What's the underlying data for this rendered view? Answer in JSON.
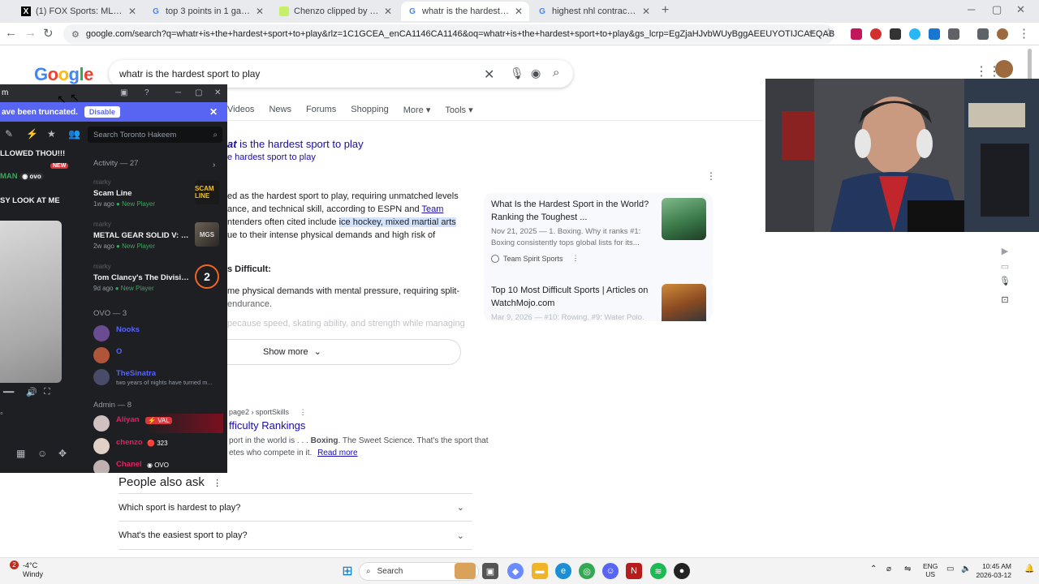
{
  "browser": {
    "tabs": [
      {
        "title": "(1) FOX Sports: MLB on X: \"THE",
        "favicon": "X",
        "active": false
      },
      {
        "title": "top 3 points in 1 game nba - G",
        "favicon": "G",
        "active": false
      },
      {
        "title": "Chenzo clipped by TheSinatra",
        "favicon": "twitch",
        "active": false
      },
      {
        "title": "whatr is the hardest sport to pl",
        "favicon": "G",
        "active": true
      },
      {
        "title": "highest nhl contract - Google S",
        "favicon": "G",
        "active": false
      }
    ],
    "new_tab": "+",
    "url": "google.com/search?q=whatr+is+the+hardest+sport+to+play&rlz=1C1GCEA_enCA1146CA1146&oq=whatr+is+the+hardest+sport+to+play&gs_lcrp=EgZjaHJvbWUyBggAEEUYOTIJCAEQABgNGIAEMgkIAhAAGA0Yg..."
  },
  "google": {
    "logo": "Google",
    "query": "whatr is the hardest sport to play",
    "tabs": [
      "Videos",
      "News",
      "Forums",
      "Shopping",
      "More",
      "Tools"
    ],
    "ai_overview": {
      "title_em": "at",
      "title_rest": " is the hardest sport to play",
      "subtitle": "e hardest sport to play",
      "lines": [
        "ed as the hardest sport to play, requiring unmatched levels",
        "ance, and technical skill, according to ESPN and ",
        "ntenders often cited include ",
        "ue to their intense physical demands and high risk of"
      ],
      "link_team": "Team",
      "highlight": "ice hockey, mixed martial arts",
      "heading": "s Difficult:",
      "line5": "me physical demands with mental pressure, requiring split-",
      "line6": "endurance.",
      "line7": "pecause speed, skating ability, and strength while managing",
      "show_more": "Show more"
    },
    "cards": [
      {
        "title": "What Is the Hardest Sport in the World? Ranking the Toughest ...",
        "snippet": "Nov 21, 2025 — 1. Boxing. Why it ranks #1: Boxing consistently tops global lists for its...",
        "source": "Team Spirit Sports"
      },
      {
        "title": "Top 10 Most Difficult Sports | Articles on WatchMojo.com",
        "snippet": "Mar 9, 2026 — #10: Rowing. #9: Water Polo."
      }
    ],
    "result2": {
      "url": "page2 › sportSkills",
      "title": "fficulty Rankings",
      "snippet1_pre": "port in the world is . . . ",
      "snippet1_bold": "Boxing",
      "snippet1_post": ". The Sweet Science. That's the sport that",
      "snippet2": "etes who compete in it.",
      "read_more": "Read more"
    },
    "paa": {
      "title": "People also ask",
      "items": [
        "Which sport is hardest to play?",
        "What's the easiest sport to play?"
      ]
    }
  },
  "chat": {
    "window_title": "m",
    "truncated_msg": "ave been truncated.",
    "disable_label": "Disable",
    "search_placeholder": "Search Toronto Hakeem",
    "left_lines": [
      "LLOWED THOU!!!",
      "MAN",
      "NEW",
      "SY LOOK AT ME"
    ],
    "ovo_tag": "ovo",
    "activity_header": "Activity — 27",
    "activities": [
      {
        "who": "marky",
        "name": "Scam Line",
        "time": "1w ago",
        "status": "New Player",
        "art": "SCAM LINE",
        "art_color": "#1a1a1a"
      },
      {
        "who": "marky",
        "name": "METAL GEAR SOLID V: GR...",
        "time": "2w ago",
        "status": "New Player",
        "art": "MGS",
        "art_color": "#55504a"
      },
      {
        "who": "marky",
        "name": "Tom Clancy's The Division 2",
        "time": "9d ago",
        "status": "New Player",
        "art": "2",
        "art_color": "#1e1f22"
      }
    ],
    "ovo_header": "OVO — 3",
    "ovo_members": [
      {
        "name": "Nooks",
        "color": "#5865f2",
        "status": ""
      },
      {
        "name": "O",
        "color": "#5865f2",
        "status": ""
      },
      {
        "name": "TheSinatra",
        "color": "#5865f2",
        "status": "two years of nights have turned m..."
      }
    ],
    "admin_header": "Admin — 8",
    "admin_members": [
      {
        "name": "Aliyan",
        "color": "#e91e63",
        "tag": "VAL"
      },
      {
        "name": "chenzo",
        "color": "#e91e63",
        "tag": "323"
      },
      {
        "name": "Chanel",
        "color": "#e91e63",
        "tag": "OVO"
      }
    ]
  },
  "taskbar": {
    "weather_temp": "-4°C",
    "weather_desc": "Windy",
    "weather_badge": "2",
    "search_label": "Search",
    "lang": "ENG",
    "region": "US",
    "time": "10:45 AM",
    "date": "2026-03-12"
  }
}
